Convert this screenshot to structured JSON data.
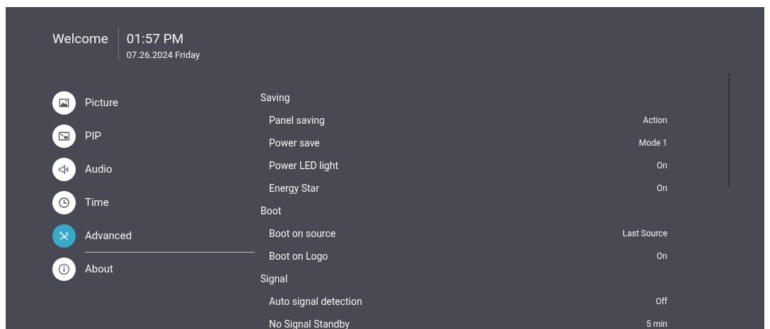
{
  "header": {
    "greeting": "Welcome",
    "time": "01:57 PM",
    "date": "07.26.2024 Friday"
  },
  "menu": [
    {
      "label": "Picture",
      "selected": false
    },
    {
      "label": "PIP",
      "selected": false
    },
    {
      "label": "Audio",
      "selected": false
    },
    {
      "label": "Time",
      "selected": false
    },
    {
      "label": "Advanced",
      "selected": true
    },
    {
      "label": "About",
      "selected": false
    }
  ],
  "sections": [
    {
      "title": "Saving",
      "items": [
        {
          "label": "Panel saving",
          "value": "Action"
        },
        {
          "label": "Power save",
          "value": "Mode 1"
        },
        {
          "label": "Power LED light",
          "value": "On"
        },
        {
          "label": "Energy Star",
          "value": "On"
        }
      ]
    },
    {
      "title": "Boot",
      "items": [
        {
          "label": "Boot on source",
          "value": "Last Source"
        },
        {
          "label": "Boot on Logo",
          "value": "On"
        }
      ]
    },
    {
      "title": "Signal",
      "items": [
        {
          "label": "Auto signal detection",
          "value": "Off"
        },
        {
          "label": "No Signal Standby",
          "value": "5 min"
        }
      ]
    }
  ]
}
